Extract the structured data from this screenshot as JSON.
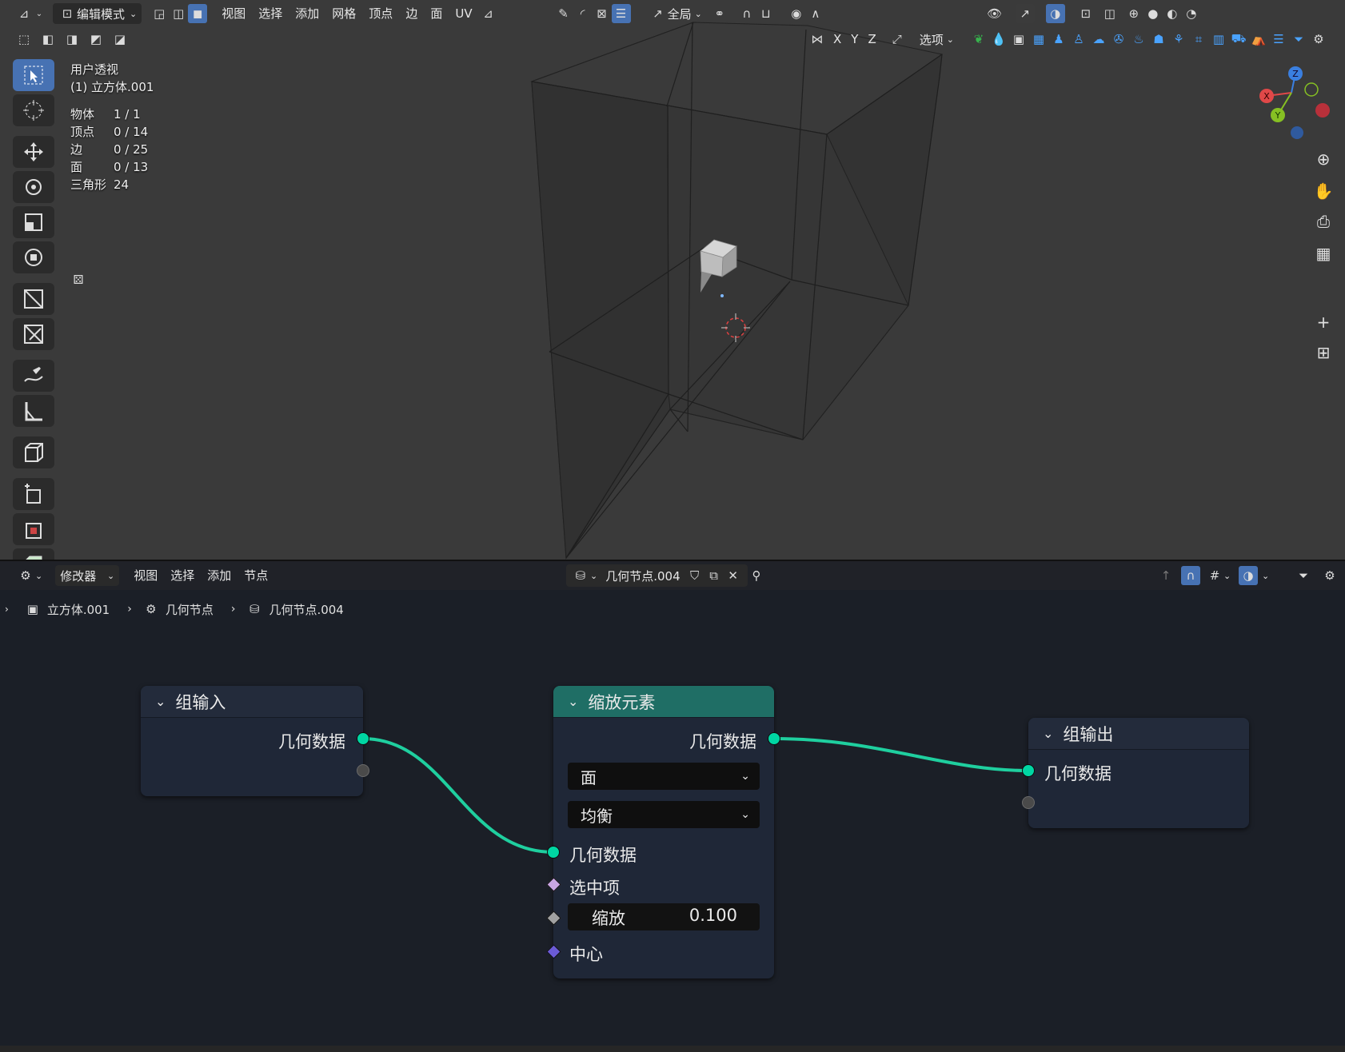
{
  "viewport": {
    "header": {
      "mode_label": "编辑模式",
      "menus": [
        "视图",
        "选择",
        "添加",
        "网格",
        "顶点",
        "边",
        "面",
        "UV"
      ],
      "transform_orientation": "全局",
      "options_label": "选项",
      "axes": [
        "X",
        "Y",
        "Z"
      ]
    },
    "overlay": {
      "view_name": "用户透视",
      "object_name": "(1) 立方体.001",
      "stats": [
        {
          "label": "物体",
          "value": "1 / 1"
        },
        {
          "label": "顶点",
          "value": "0 / 14"
        },
        {
          "label": "边",
          "value": "0 / 25"
        },
        {
          "label": "面",
          "value": "0 / 13"
        },
        {
          "label": "三角形",
          "value": "24"
        }
      ]
    },
    "gizmo": {
      "x": "X",
      "y": "Y",
      "z": "Z"
    }
  },
  "node_editor": {
    "header": {
      "editor_type": "修改器",
      "menus": [
        "视图",
        "选择",
        "添加",
        "节点"
      ],
      "node_group_name": "几何节点.004"
    },
    "breadcrumb": [
      "立方体.001",
      "几何节点",
      "几何节点.004"
    ],
    "nodes": {
      "group_input": {
        "title": "组输入",
        "outputs": [
          "几何数据"
        ]
      },
      "scale_elements": {
        "title": "缩放元素",
        "output": "几何数据",
        "domain": "面",
        "scale_mode": "均衡",
        "inputs": {
          "geometry": "几何数据",
          "selection": "选中项",
          "scale_label": "缩放",
          "scale_value": "0.100",
          "center": "中心"
        }
      },
      "group_output": {
        "title": "组输出",
        "inputs": [
          "几何数据"
        ]
      }
    },
    "colors": {
      "geometry_socket": "#00d6a3",
      "node_header_teal": "#1f6e65",
      "selection_socket": "#c9a6e4",
      "vector_socket": "#6b5bd6",
      "float_socket": "#a1a1a1"
    }
  }
}
